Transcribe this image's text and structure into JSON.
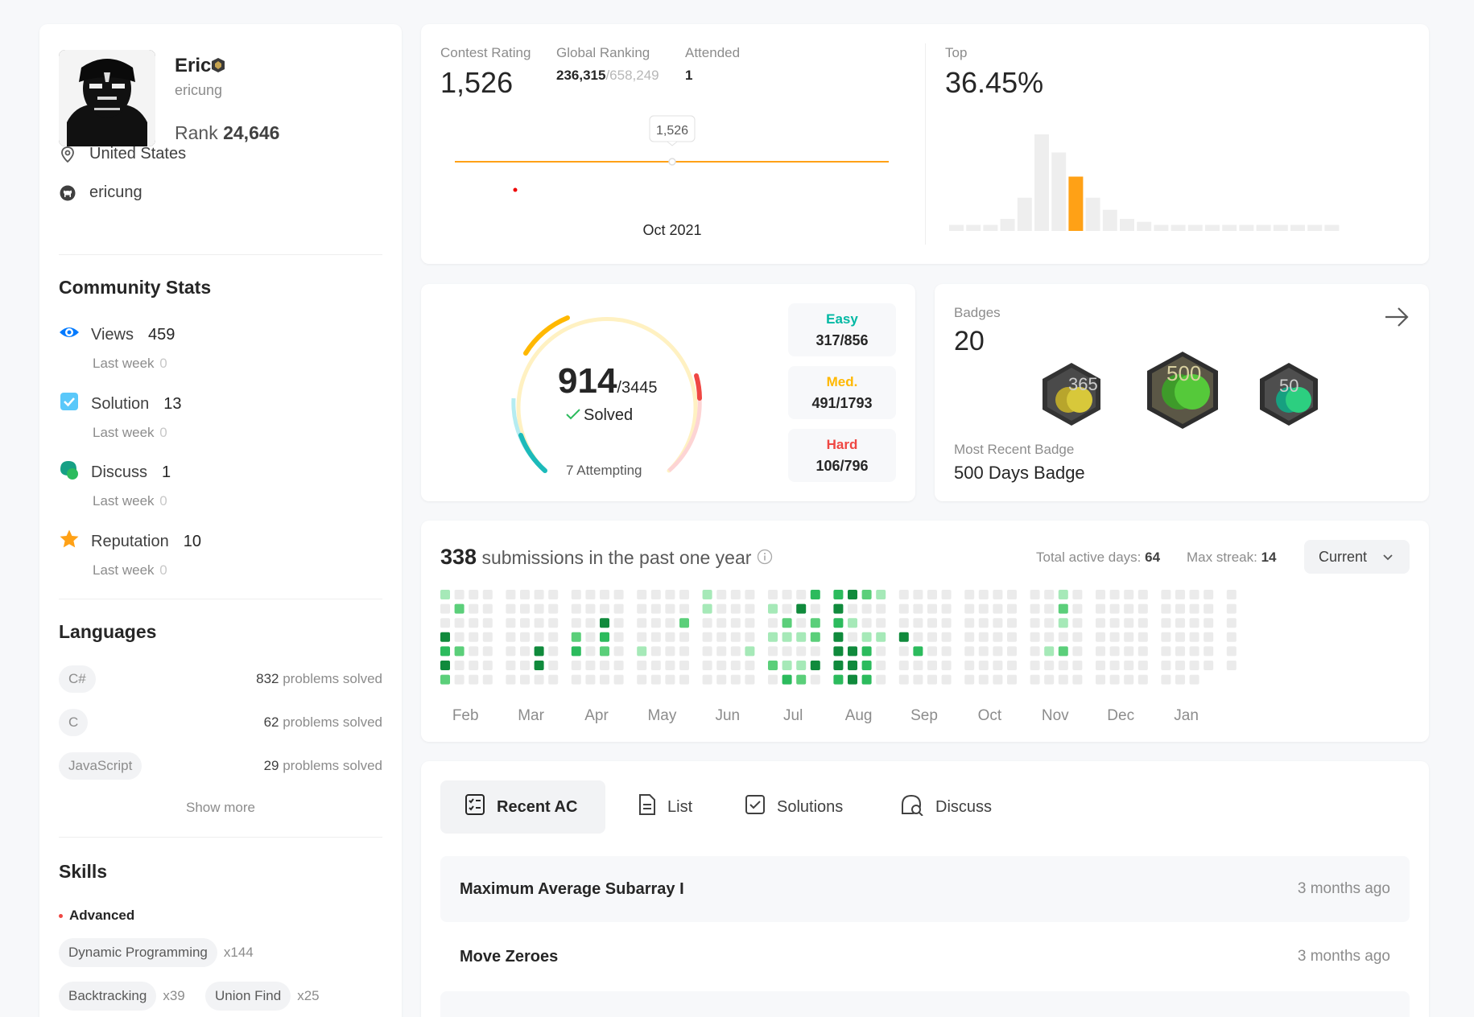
{
  "profile": {
    "name": "Eric",
    "username": "ericung",
    "rank_label": "Rank",
    "rank_value": "24,646",
    "location": "United States",
    "github": "ericung"
  },
  "community": {
    "title": "Community Stats",
    "items": [
      {
        "label": "Views",
        "value": "459",
        "sub": "Last week",
        "sub_value": "0",
        "icon": "eye-icon",
        "color": "#007aff"
      },
      {
        "label": "Solution",
        "value": "13",
        "sub": "Last week",
        "sub_value": "0",
        "icon": "check-square-icon",
        "color": "#5ac8fa"
      },
      {
        "label": "Discuss",
        "value": "1",
        "sub": "Last week",
        "sub_value": "0",
        "icon": "chat-bubbles-icon",
        "color": "#2cbb5d"
      },
      {
        "label": "Reputation",
        "value": "10",
        "sub": "Last week",
        "sub_value": "0",
        "icon": "star-icon",
        "color": "#ffa116"
      }
    ]
  },
  "languages": {
    "title": "Languages",
    "items": [
      {
        "name": "C#",
        "count": "832",
        "suffix": "problems solved"
      },
      {
        "name": "C",
        "count": "62",
        "suffix": "problems solved"
      },
      {
        "name": "JavaScript",
        "count": "29",
        "suffix": "problems solved"
      }
    ],
    "show_more": "Show more"
  },
  "skills": {
    "title": "Skills",
    "level": "Advanced",
    "items": [
      {
        "name": "Dynamic Programming",
        "count": "x144"
      },
      {
        "name": "Backtracking",
        "count": "x39"
      },
      {
        "name": "Union Find",
        "count": "x25"
      }
    ]
  },
  "contest": {
    "rating_label": "Contest Rating",
    "rating_value": "1,526",
    "global_label": "Global Ranking",
    "global_value": "236,315",
    "global_total": "/658,249",
    "attended_label": "Attended",
    "attended_value": "1",
    "tooltip": "1,526",
    "x_label": "Oct 2021",
    "top_label": "Top",
    "top_value": "36.45%",
    "line_color": "#ffa116",
    "histogram_percent": [
      2,
      2,
      2,
      4,
      11,
      32,
      26,
      18,
      11,
      7,
      4,
      3,
      2,
      2,
      2,
      2,
      2,
      2,
      2,
      2,
      2,
      2,
      2
    ],
    "histogram_highlight_index": 7
  },
  "solved": {
    "count": "914",
    "total": "/3445",
    "solved_label": "Solved",
    "attempting": "7 Attempting",
    "easy_label": "Easy",
    "easy_value": "317/856",
    "easy_color": "#00b8a3",
    "med_label": "Med.",
    "med_value": "491/1793",
    "med_color": "#ffb800",
    "hard_label": "Hard",
    "hard_value": "106/796",
    "hard_color": "#ef4743"
  },
  "badges": {
    "label": "Badges",
    "count": "20",
    "recent_label": "Most Recent Badge",
    "recent_value": "500 Days Badge",
    "badge_names": [
      "365-days-badge-icon",
      "500-days-badge-icon",
      "50-days-badge-icon"
    ]
  },
  "heatmap": {
    "count": "338",
    "title_rest": "submissions in the past one year",
    "active_label": "Total active days:",
    "active_value": "64",
    "streak_label": "Max streak:",
    "streak_value": "14",
    "select_value": "Current",
    "months": [
      "Feb",
      "Mar",
      "Apr",
      "May",
      "Jun",
      "Jul",
      "Aug",
      "Sep",
      "Oct",
      "Nov",
      "Dec",
      "Jan"
    ],
    "colors": [
      "#ebebeb",
      "#a6e9b8",
      "#5bcf7a",
      "#2cbb5d",
      "#108a3c"
    ]
  },
  "submissions": {
    "tabs": [
      {
        "label": "Recent AC",
        "icon": "checklist-icon"
      },
      {
        "label": "List",
        "icon": "document-icon"
      },
      {
        "label": "Solutions",
        "icon": "check-square-icon"
      },
      {
        "label": "Discuss",
        "icon": "discuss-icon"
      }
    ],
    "rows": [
      {
        "title": "Maximum Average Subarray I",
        "when": "3 months ago"
      },
      {
        "title": "Move Zeroes",
        "when": "3 months ago"
      }
    ]
  }
}
